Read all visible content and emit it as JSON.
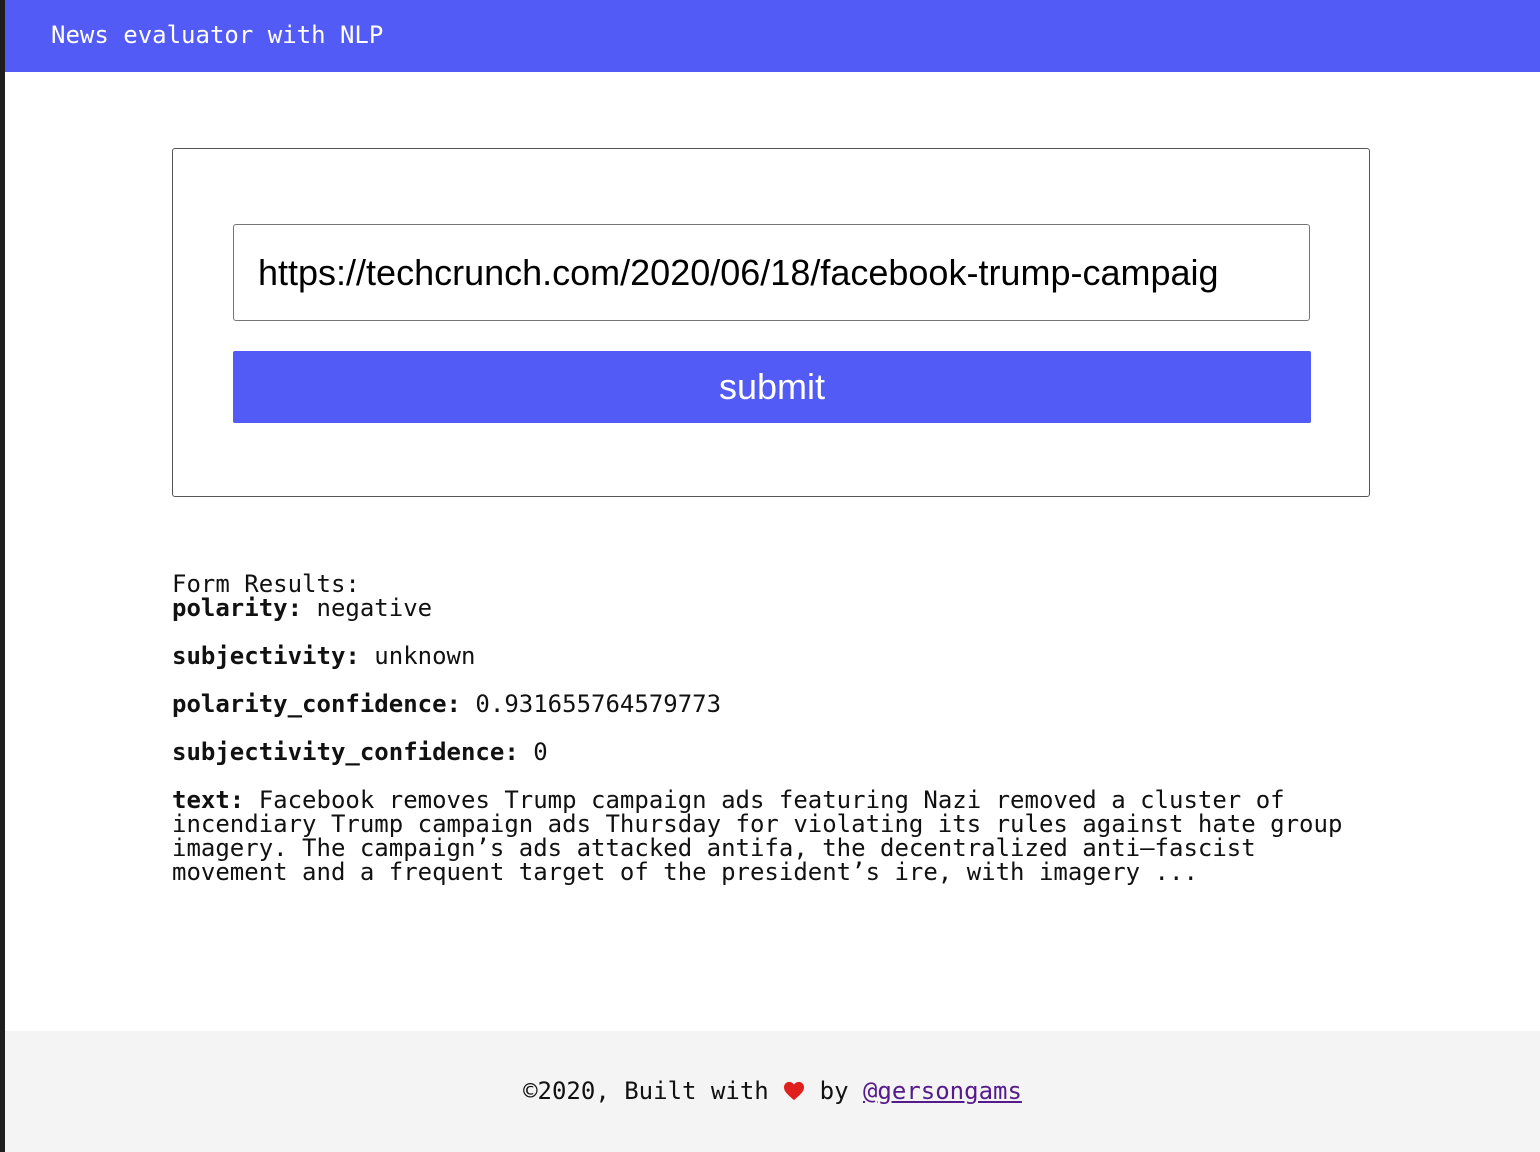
{
  "header": {
    "title": "News evaluator with NLP",
    "background_color": "#535bf7"
  },
  "form": {
    "url_input_value": "https://techcrunch.com/2020/06/18/facebook-trump-campaig",
    "submit_label": "submit"
  },
  "results": {
    "heading": "Form Results:",
    "fields": [
      {
        "key": "polarity:",
        "value": " negative"
      },
      {
        "key": "subjectivity:",
        "value": " unknown"
      },
      {
        "key": "polarity_confidence:",
        "value": " 0.931655764579773"
      },
      {
        "key": "subjectivity_confidence:",
        "value": " 0"
      }
    ],
    "text_key": "text:",
    "text_value": " Facebook removes Trump campaign ads featuring Nazi removed a cluster of incendiary Trump campaign ads Thursday for violating its rules against hate group imagery. The campaign’s ads attacked antifa, the decentralized anti–fascist movement and a frequent target of the president’s ire, with imagery ..."
  },
  "footer": {
    "prefix": "©2020, Built with ",
    "icon": "heart-icon",
    "middle": " by ",
    "link_text": "@gersongams",
    "heart_color": "#e0201c",
    "link_color": "#551a8b"
  }
}
